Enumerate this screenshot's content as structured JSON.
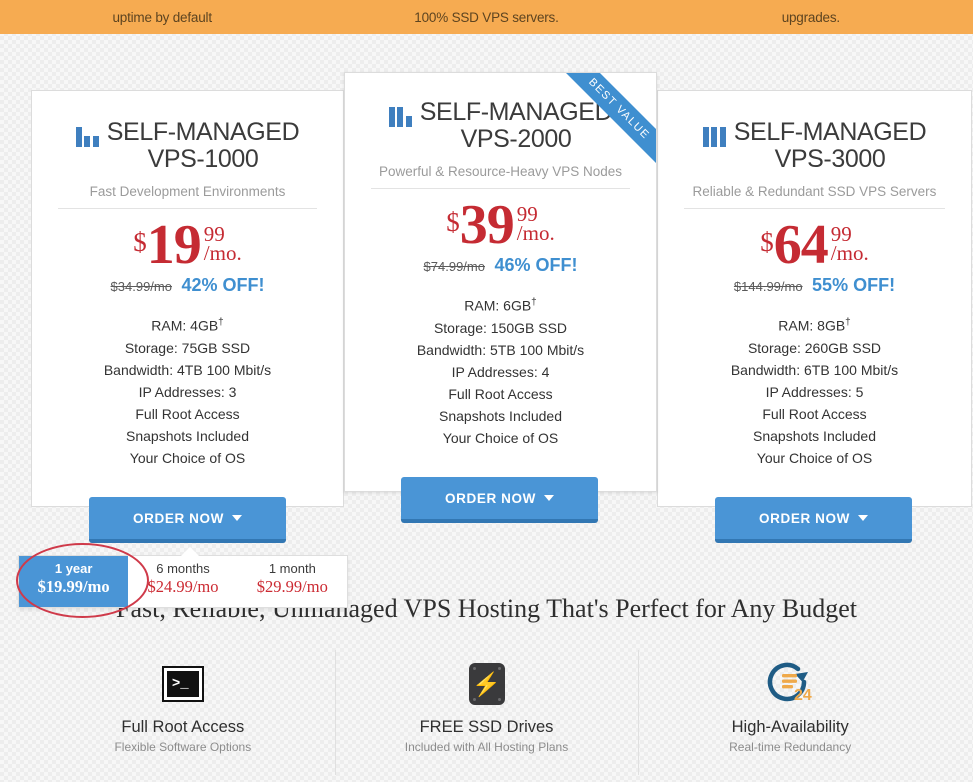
{
  "topbar": {
    "columns": [
      "uptime by default",
      "100% SSD VPS servers.",
      "upgrades."
    ],
    "bg_color": "#f6ab51"
  },
  "colors": {
    "accent_blue": "#4a95d6",
    "price_red": "#c52b33",
    "discount_blue": "#3f8fd0",
    "annotation_red": "#cf3a4a",
    "icon_orange": "#f0a92e"
  },
  "plans": [
    {
      "icon": "bar-chart-1-icon",
      "bars": [
        "tall",
        "short",
        "short"
      ],
      "title_line1": "SELF-MANAGED",
      "title_line2": "VPS-1000",
      "subtitle": "Fast Development Environments",
      "currency": "$",
      "price_int": "19",
      "price_cents": "99",
      "price_per": "/mo.",
      "old_price": "$34.99/mo",
      "discount": "42% OFF!",
      "features": [
        "RAM: 4GB",
        "Storage: 75GB SSD",
        "Bandwidth: 4TB 100 Mbit/s",
        "IP Addresses: 3",
        "Full Root Access",
        "Snapshots Included",
        "Your Choice of OS"
      ],
      "ram_dagger": "†",
      "order_label": "ORDER NOW",
      "ribbon": null
    },
    {
      "icon": "bar-chart-2-icon",
      "bars": [
        "tall",
        "tall",
        "short"
      ],
      "title_line1": "SELF-MANAGED",
      "title_line2": "VPS-2000",
      "subtitle": "Powerful & Resource-Heavy VPS Nodes",
      "currency": "$",
      "price_int": "39",
      "price_cents": "99",
      "price_per": "/mo.",
      "old_price": "$74.99/mo",
      "discount": "46% OFF!",
      "features": [
        "RAM: 6GB",
        "Storage: 150GB SSD",
        "Bandwidth: 5TB 100 Mbit/s",
        "IP Addresses: 4",
        "Full Root Access",
        "Snapshots Included",
        "Your Choice of OS"
      ],
      "ram_dagger": "†",
      "order_label": "ORDER NOW",
      "ribbon": "BEST VALUE"
    },
    {
      "icon": "bar-chart-3-icon",
      "bars": [
        "tall",
        "tall",
        "tall"
      ],
      "title_line1": "SELF-MANAGED",
      "title_line2": "VPS-3000",
      "subtitle": "Reliable & Redundant SSD VPS Servers",
      "currency": "$",
      "price_int": "64",
      "price_cents": "99",
      "price_per": "/mo.",
      "old_price": "$144.99/mo",
      "discount": "55% OFF!",
      "features": [
        "RAM: 8GB",
        "Storage: 260GB SSD",
        "Bandwidth: 6TB 100 Mbit/s",
        "IP Addresses: 5",
        "Full Root Access",
        "Snapshots Included",
        "Your Choice of OS"
      ],
      "ram_dagger": "†",
      "order_label": "ORDER NOW",
      "ribbon": null
    }
  ],
  "period_dropdown": {
    "options": [
      {
        "label": "1 year",
        "amount": "$19.99/mo",
        "selected": true
      },
      {
        "label": "6 months",
        "amount": "$24.99/mo",
        "selected": false
      },
      {
        "label": "1 month",
        "amount": "$29.99/mo",
        "selected": false
      }
    ]
  },
  "headline": "Fast, Reliable, Unmanaged VPS Hosting That's Perfect for Any Budget",
  "features_strip": [
    {
      "icon": "terminal-icon",
      "glyph": ">_",
      "title": "Full Root Access",
      "subtitle": "Flexible Software Options"
    },
    {
      "icon": "ssd-drive-icon",
      "glyph": "⚡",
      "title": "FREE SSD Drives",
      "subtitle": "Included with All Hosting Plans"
    },
    {
      "icon": "availability-24-icon",
      "glyph": "24",
      "title": "High-Availability",
      "subtitle": "Real-time Redundancy"
    }
  ]
}
